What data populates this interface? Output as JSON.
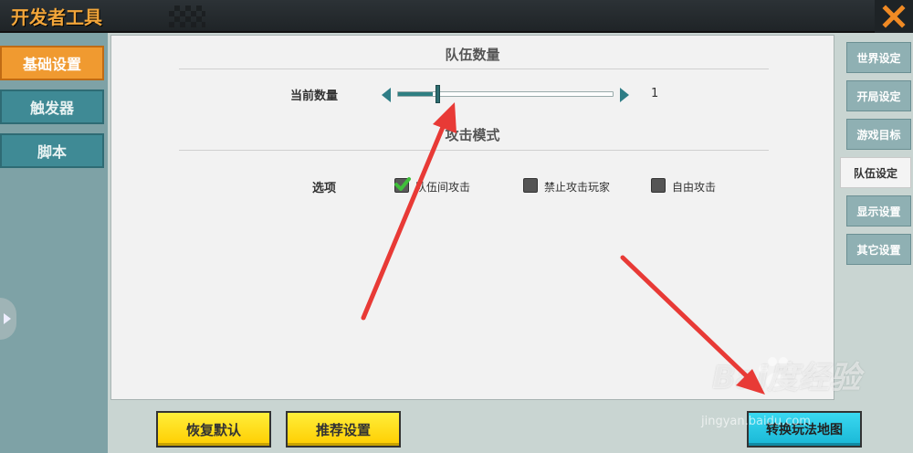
{
  "window": {
    "title": "开发者工具"
  },
  "left_sidebar": {
    "tabs": [
      {
        "label": "基础设置",
        "active": true
      },
      {
        "label": "触发器",
        "active": false
      },
      {
        "label": "脚本",
        "active": false
      }
    ]
  },
  "main": {
    "team_count_section": {
      "title": "队伍数量",
      "current_label": "当前数量",
      "current_value": "1",
      "slider_fraction": 0.16
    },
    "attack_mode_section": {
      "title": "攻击模式",
      "options_label": "选项",
      "options": [
        {
          "label": "队伍间攻击",
          "checked": true
        },
        {
          "label": "禁止攻击玩家",
          "checked": false
        },
        {
          "label": "自由攻击",
          "checked": false
        }
      ]
    }
  },
  "right_sidebar": {
    "tabs": [
      {
        "label": "世界设定",
        "active": false
      },
      {
        "label": "开局设定",
        "active": false
      },
      {
        "label": "游戏目标",
        "active": false
      },
      {
        "label": "队伍设定",
        "active": true
      },
      {
        "label": "显示设置",
        "active": false
      },
      {
        "label": "其它设置",
        "active": false
      }
    ]
  },
  "footer": {
    "restore_default_label": "恢复默认",
    "recommended_label": "推荐设置",
    "convert_map_label": "转换玩法地图"
  },
  "watermark": {
    "brand": "Bai度经验",
    "url": "jingyan.baidu.com"
  },
  "colors": {
    "accent_orange": "#f09a30",
    "teal": "#2e7d86",
    "button_yellow": "#ffdc1a",
    "button_blue": "#22c4e0",
    "annotation_red": "#e83a36"
  }
}
